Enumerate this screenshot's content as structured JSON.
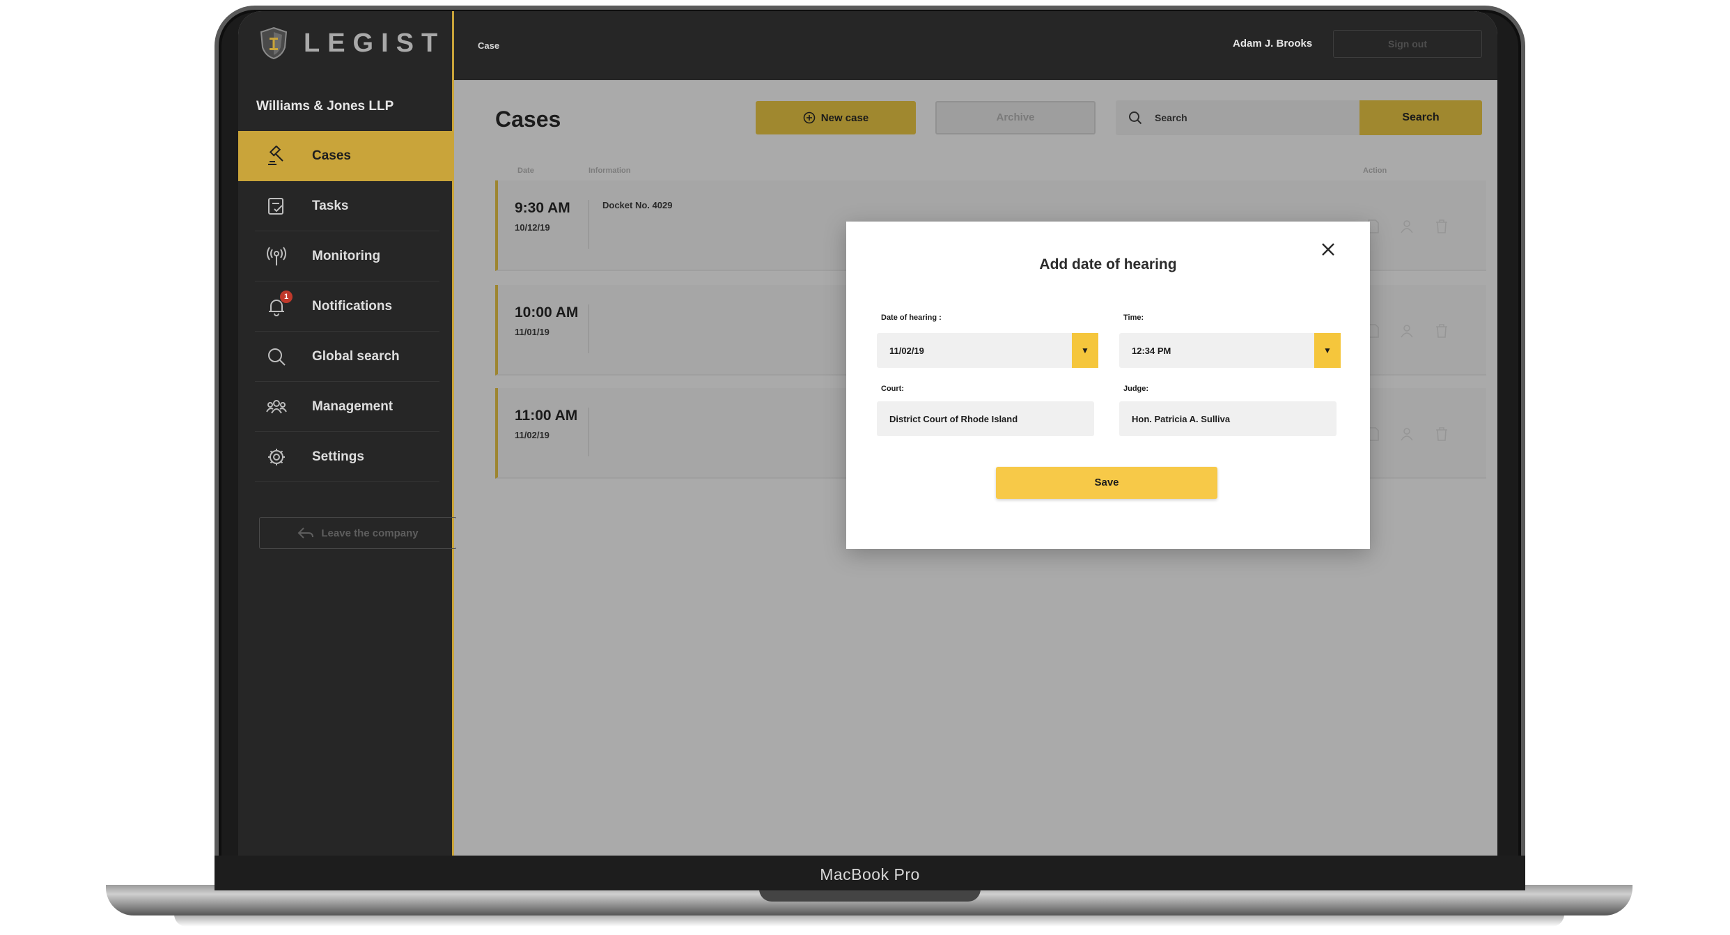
{
  "device": {
    "label": "MacBook Pro"
  },
  "brand": {
    "name": "LEGIST",
    "accent": "#c9a43a",
    "modal_accent": "#f7c948"
  },
  "sidebar": {
    "company": "Williams & Jones LLP",
    "items": [
      {
        "label": "Cases",
        "icon": "gavel-icon",
        "active": true
      },
      {
        "label": "Tasks",
        "icon": "tasks-icon"
      },
      {
        "label": "Monitoring",
        "icon": "broadcast-icon"
      },
      {
        "label": "Notifications",
        "icon": "bell-icon",
        "badge": "1"
      },
      {
        "label": "Global search",
        "icon": "search-icon"
      },
      {
        "label": "Management",
        "icon": "people-icon"
      },
      {
        "label": "Settings",
        "icon": "gear-icon"
      }
    ],
    "leave_label": "Leave the company"
  },
  "header": {
    "breadcrumb": "Case",
    "user": "Adam J. Brooks",
    "signout_label": "Sign out"
  },
  "main": {
    "title": "Cases",
    "new_case_label": "New case",
    "archive_label": "Archive",
    "search_placeholder": "Search",
    "search_button": "Search",
    "columns": {
      "date": "Date",
      "information": "Information",
      "action": "Action"
    },
    "rows": [
      {
        "time": "9:30 AM",
        "date": "10/12/19",
        "info": "Docket No. 4029"
      },
      {
        "time": "10:00 AM",
        "date": "11/01/19",
        "info": ""
      },
      {
        "time": "11:00 AM",
        "date": "11/02/19",
        "info": ""
      }
    ]
  },
  "modal": {
    "title": "Add date of hearing",
    "date_label": "Date of hearing :",
    "date_value": "11/02/19",
    "time_label": "Time:",
    "time_value": "12:34 PM",
    "court_label": "Court:",
    "court_value": "District Court of Rhode Island",
    "judge_label": "Judge:",
    "judge_value": "Hon. Patricia A. Sulliva",
    "save_label": "Save"
  }
}
